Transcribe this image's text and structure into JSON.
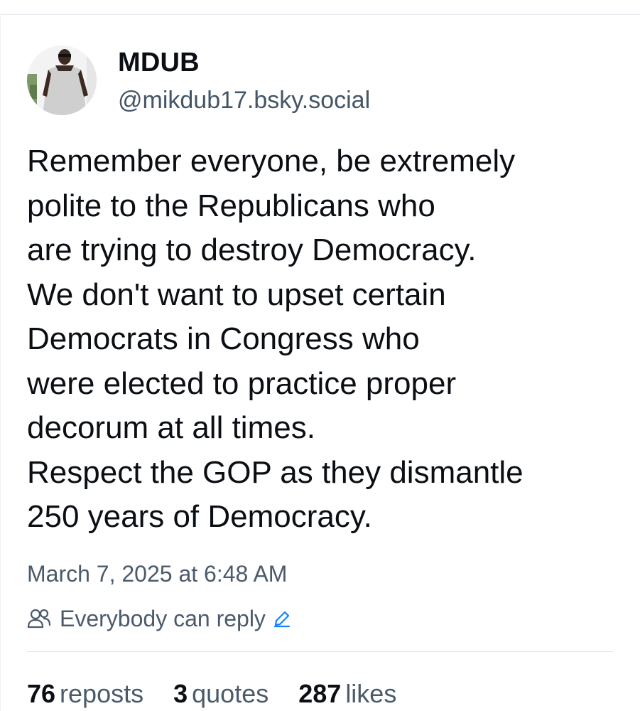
{
  "author": {
    "display_name": "MDUB",
    "handle": "@mikdub17.bsky.social",
    "avatar_icon": "profile-photo"
  },
  "post": {
    "lines": [
      "Remember everyone, be extremely",
      "polite to the Republicans who",
      "are trying to destroy Democracy.",
      "We don't want to upset certain",
      "Democrats in Congress who",
      "were elected to practice proper",
      "decorum at all times.",
      "Respect the GOP as they dismantle",
      "250 years of Democracy."
    ]
  },
  "meta": {
    "timestamp": "March 7, 2025 at 6:48 AM",
    "reply_setting": "Everybody can reply",
    "people_icon": "people-icon",
    "edit_icon": "pencil-icon"
  },
  "stats": {
    "reposts_count": "76",
    "reposts_label": "reposts",
    "quotes_count": "3",
    "quotes_label": "quotes",
    "likes_count": "287",
    "likes_label": "likes"
  },
  "colors": {
    "text_primary": "#0b0f14",
    "text_secondary": "#4b5a6b",
    "accent": "#1083fe"
  }
}
